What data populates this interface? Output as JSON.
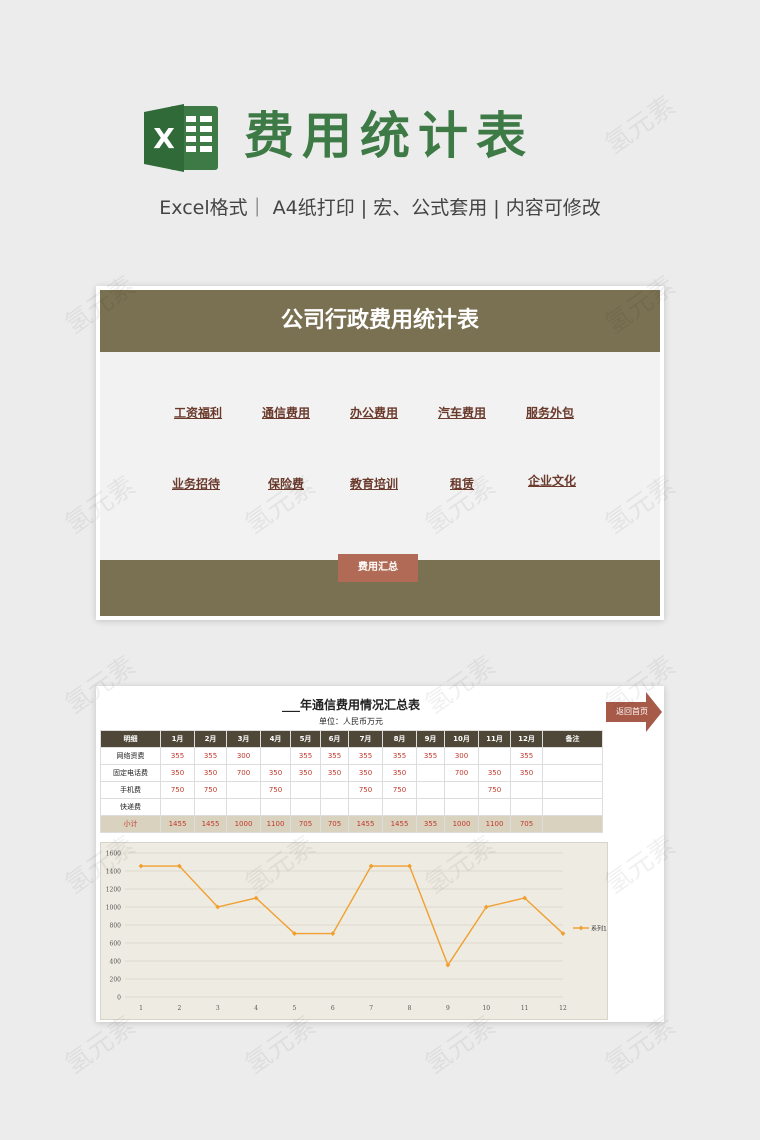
{
  "header": {
    "title": "费用统计表",
    "subtitle": "Excel格式｜ A4纸打印 | 宏、公式套用 | 内容可修改"
  },
  "sheet1": {
    "title": "公司行政费用统计表",
    "nav_row1": [
      "工资福利",
      "通信费用",
      "办公费用",
      "汽车费用",
      "服务外包"
    ],
    "nav_row2": [
      "业务招待",
      "保险费",
      "教育培训",
      "租赁",
      "企业文化"
    ],
    "summary_button": "费用汇总"
  },
  "sheet2": {
    "title": "___年通信费用情况汇总表",
    "unit": "单位：人民币万元",
    "back_button": "返回首页",
    "table": {
      "headers": [
        "明细",
        "1月",
        "2月",
        "3月",
        "4月",
        "5月",
        "6月",
        "7月",
        "8月",
        "9月",
        "10月",
        "11月",
        "12月",
        "备注"
      ],
      "rows": [
        [
          "网络资费",
          "355",
          "355",
          "300",
          "",
          "355",
          "355",
          "355",
          "355",
          "355",
          "300",
          "",
          "355",
          ""
        ],
        [
          "固定电话费",
          "350",
          "350",
          "700",
          "350",
          "350",
          "350",
          "350",
          "350",
          "",
          "700",
          "350",
          "350",
          ""
        ],
        [
          "手机费",
          "750",
          "750",
          "",
          "750",
          "",
          "",
          "750",
          "750",
          "",
          "",
          "750",
          "",
          ""
        ],
        [
          "快递费",
          "",
          "",
          "",
          "",
          "",
          "",
          "",
          "",
          "",
          "",
          "",
          "",
          ""
        ]
      ],
      "total_row": [
        "小计",
        "1455",
        "1455",
        "1000",
        "1100",
        "705",
        "705",
        "1455",
        "1455",
        "355",
        "1000",
        "1100",
        "705",
        ""
      ]
    }
  },
  "chart_data": {
    "type": "line",
    "x": [
      1,
      2,
      3,
      4,
      5,
      6,
      7,
      8,
      9,
      10,
      11,
      12
    ],
    "series": [
      {
        "name": "系列1",
        "values": [
          1455,
          1455,
          1000,
          1100,
          705,
          705,
          1455,
          1455,
          355,
          1000,
          1100,
          705
        ]
      }
    ],
    "ylim": [
      0,
      1600
    ],
    "yticks": [
      0,
      200,
      400,
      600,
      800,
      1000,
      1200,
      1400,
      1600
    ],
    "grid": true,
    "legend": "right",
    "line_color": "#f0a030"
  },
  "watermark": "氢元素"
}
